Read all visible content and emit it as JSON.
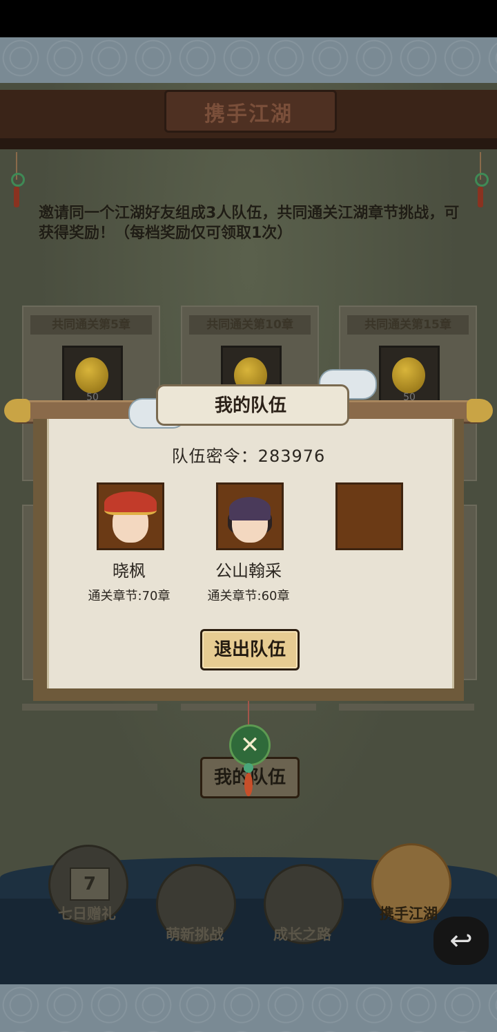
{
  "header": {
    "title": "携手江湖"
  },
  "description": "邀请同一个江湖好友组成3人队伍，共同通关江湖章节挑战，可获得奖励！（每档奖励仅可领取1次）",
  "reward_cards": [
    {
      "title": "共同通关第5章",
      "count": "50"
    },
    {
      "title": "共同通关第10章",
      "count": ""
    },
    {
      "title": "共同通关第15章",
      "count": "50"
    }
  ],
  "modal": {
    "title": "我的队伍",
    "passcode": "队伍密令：283976",
    "members": [
      {
        "name": "晓枫",
        "chapters": "通关章节:70章"
      },
      {
        "name": "公山翰采",
        "chapters": "通关章节:60章"
      }
    ],
    "leave_button": "退出队伍",
    "close_symbol": "✕"
  },
  "my_team_button": "我的队伍",
  "nav": [
    {
      "label": "七日赠礼",
      "badge": "7"
    },
    {
      "label": "萌新挑战"
    },
    {
      "label": "成长之路"
    },
    {
      "label": "携手江湖"
    }
  ],
  "back_symbol": "↩"
}
